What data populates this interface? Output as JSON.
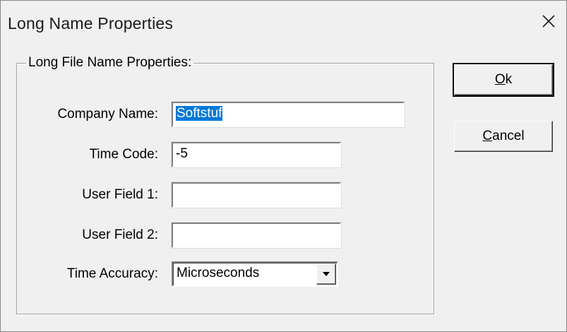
{
  "window": {
    "title": "Long Name Properties"
  },
  "group": {
    "label": "Long File Name Properties:"
  },
  "fields": {
    "company_name": {
      "label": "Company Name:",
      "value": "Softstuf"
    },
    "time_code": {
      "label": "Time Code:",
      "value": "-5"
    },
    "user_field_1": {
      "label": "User Field 1:",
      "value": ""
    },
    "user_field_2": {
      "label": "User Field 2:",
      "value": ""
    },
    "time_accuracy": {
      "label": "Time Accuracy:",
      "value": "Microseconds"
    }
  },
  "buttons": {
    "ok": "Ok",
    "cancel": "Cancel"
  },
  "icons": {
    "close": "close-icon",
    "dropdown": "dropdown-arrow-icon"
  }
}
